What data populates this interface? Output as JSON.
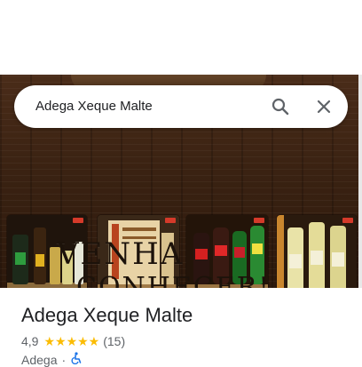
{
  "search": {
    "query": "Adega Xeque Malte",
    "search_icon": "search-icon",
    "close_icon": "close-icon"
  },
  "hero": {
    "wall_text_line1": "VENHA",
    "wall_text_line2": "CONHECER!",
    "product_images": [
      {
        "name": "product-photo-1"
      },
      {
        "name": "product-photo-2"
      },
      {
        "name": "product-photo-3"
      },
      {
        "name": "product-photo-4"
      }
    ]
  },
  "place": {
    "title": "Adega Xeque Malte",
    "rating": "4,9",
    "stars": "★★★★★",
    "review_count": "(15)",
    "category": "Adega",
    "separator": "·",
    "accessibility_icon": "wheelchair-icon"
  },
  "colors": {
    "star": "#fbbc04",
    "wood_dark": "#3a2212",
    "accessibility_blue": "#1a73e8"
  }
}
